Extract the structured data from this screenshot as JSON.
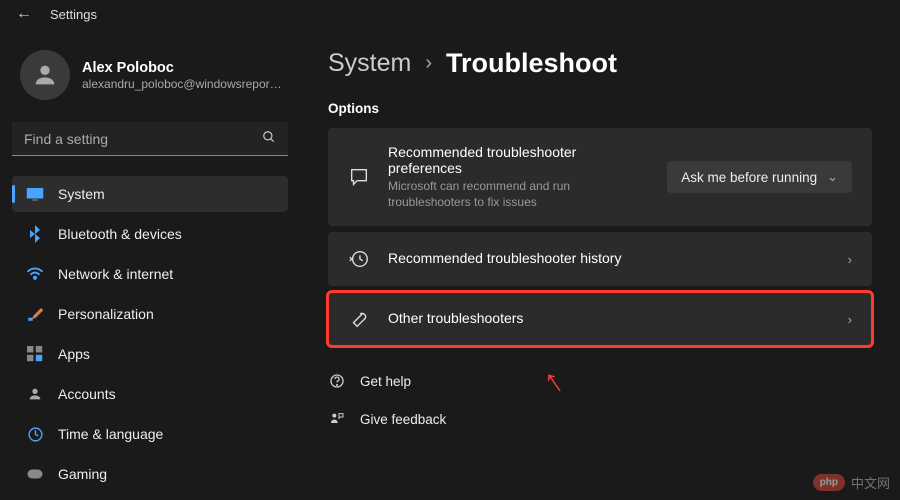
{
  "app_title": "Settings",
  "profile": {
    "name": "Alex Poloboc",
    "email": "alexandru_poloboc@windowsreport..."
  },
  "search": {
    "placeholder": "Find a setting"
  },
  "nav": [
    {
      "label": "System",
      "active": true
    },
    {
      "label": "Bluetooth & devices",
      "active": false
    },
    {
      "label": "Network & internet",
      "active": false
    },
    {
      "label": "Personalization",
      "active": false
    },
    {
      "label": "Apps",
      "active": false
    },
    {
      "label": "Accounts",
      "active": false
    },
    {
      "label": "Time & language",
      "active": false
    },
    {
      "label": "Gaming",
      "active": false
    }
  ],
  "breadcrumb": {
    "parent": "System",
    "current": "Troubleshoot"
  },
  "options_label": "Options",
  "cards": {
    "prefs": {
      "title": "Recommended troubleshooter preferences",
      "sub": "Microsoft can recommend and run troubleshooters to fix issues",
      "dropdown": "Ask me before running"
    },
    "history": {
      "title": "Recommended troubleshooter history"
    },
    "other": {
      "title": "Other troubleshooters"
    }
  },
  "help": {
    "get_help": "Get help",
    "feedback": "Give feedback"
  },
  "watermark": {
    "badge": "php",
    "text": "中文网"
  },
  "colors": {
    "accent": "#4aa3ff",
    "highlight": "#ff3b30"
  }
}
